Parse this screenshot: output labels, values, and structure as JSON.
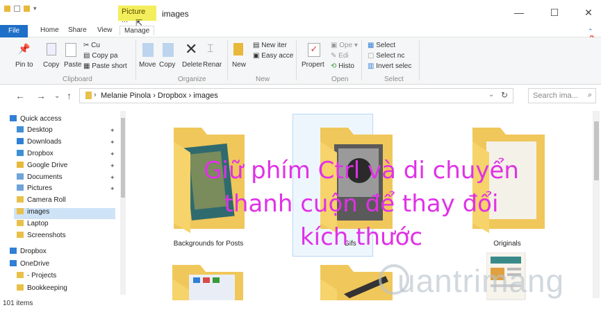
{
  "window": {
    "context_tab": "Picture ...",
    "title": "images",
    "controls": [
      "—",
      "☐",
      "✕"
    ]
  },
  "tabs": [
    {
      "label": "File"
    },
    {
      "label": "Home"
    },
    {
      "label": "Share"
    },
    {
      "label": "View"
    },
    {
      "label": "Manage"
    }
  ],
  "ribbon": {
    "clipboard": {
      "pin": "Pin to",
      "copy": "Copy",
      "paste": "Paste",
      "cut": "Cu",
      "copy_path": "Copy pa",
      "paste_shortcut": "Paste short",
      "label": "Clipboard"
    },
    "organize": {
      "move": "Move",
      "copy": "Copy",
      "delete": "Delete",
      "rename": "Renar",
      "label": "Organize"
    },
    "new": {
      "new_folder": "New",
      "new_item": "New iter",
      "easy_access": "Easy acce",
      "label": "New"
    },
    "open": {
      "properties": "Propert",
      "open": "Ope",
      "edit": "Edi",
      "history": "Histo",
      "label": "Open"
    },
    "select": {
      "select_all": "Select",
      "select_none": "Select nc",
      "invert": "Invert selec",
      "label": "Select"
    }
  },
  "address": {
    "breadcrumb": "Melanie Pinola  ›  Dropbox  ›  images",
    "search_placeholder": "Search ima..."
  },
  "sidebar": {
    "items": [
      {
        "label": "Quick access",
        "icon": "star-icon",
        "color": "#2f7fd6"
      },
      {
        "label": "Desktop",
        "icon": "desktop-folder-icon",
        "color": "#3d8fd6",
        "pinned": true
      },
      {
        "label": "Downloads",
        "icon": "download-folder-icon",
        "color": "#2f7fd6",
        "pinned": true
      },
      {
        "label": "Dropbox",
        "icon": "dropbox-folder-icon",
        "color": "#3d8fd6",
        "pinned": true
      },
      {
        "label": "Google Drive",
        "icon": "drive-folder-icon",
        "color": "#e8b83a",
        "pinned": true
      },
      {
        "label": "Documents",
        "icon": "documents-folder-icon",
        "color": "#6fa3d9",
        "pinned": true
      },
      {
        "label": "Pictures",
        "icon": "pictures-folder-icon",
        "color": "#6fa3d9",
        "pinned": true
      },
      {
        "label": "Camera Roll",
        "icon": "folder-icon",
        "color": "#e8c04a"
      },
      {
        "label": "images",
        "icon": "folder-icon",
        "color": "#e8c04a",
        "selected": true
      },
      {
        "label": "Laptop",
        "icon": "folder-icon",
        "color": "#e8c04a"
      },
      {
        "label": "Screenshots",
        "icon": "folder-icon",
        "color": "#e8c04a"
      },
      {
        "label": "Dropbox",
        "icon": "dropbox-icon",
        "color": "#2f7fd6"
      },
      {
        "label": "OneDrive",
        "icon": "onedrive-icon",
        "color": "#2f7fd6"
      },
      {
        "label": "- Projects",
        "icon": "folder-icon",
        "color": "#e8c04a"
      },
      {
        "label": "Bookkeeping",
        "icon": "folder-icon",
        "color": "#e8c04a"
      }
    ]
  },
  "folders": [
    {
      "name": "Backgrounds for Posts"
    },
    {
      "name": "Gifs"
    },
    {
      "name": "Originals"
    }
  ],
  "status": "101 items",
  "overlay": {
    "line1": "Giữ phím Ctrl và di chuyển",
    "line2": "thanh cuộn để thay đổi",
    "line3": "kích thước"
  },
  "watermark": "uantrimang",
  "colors": {
    "accent": "#1e6fc7",
    "overlay_text": "#e031e6",
    "folder": "#f6d36b",
    "context_tab": "#f3ef5c"
  }
}
